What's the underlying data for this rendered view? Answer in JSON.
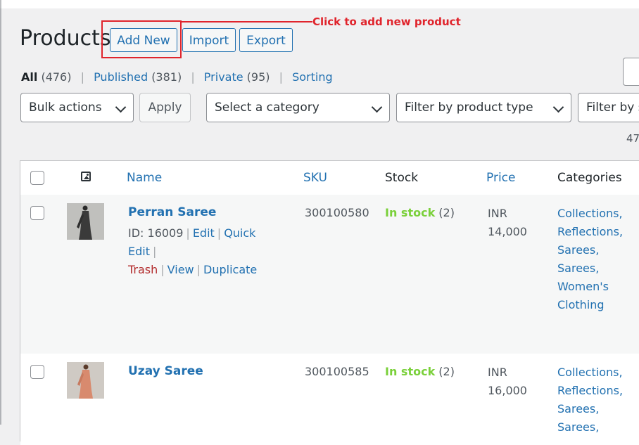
{
  "page": {
    "title": "Products",
    "buttons": {
      "add_new": "Add New",
      "import": "Import",
      "export": "Export"
    }
  },
  "annotation": {
    "text": "Click to add new product",
    "color": "#e0242c"
  },
  "views": {
    "all": {
      "label": "All",
      "count": "(476)"
    },
    "published": {
      "label": "Published",
      "count": "(381)"
    },
    "private": {
      "label": "Private",
      "count": "(95)"
    },
    "sorting": {
      "label": "Sorting"
    },
    "separator": "|"
  },
  "filters": {
    "bulk_actions": "Bulk actions",
    "apply": "Apply",
    "category": "Select a category",
    "product_type": "Filter by product type",
    "stock": "Filter by s"
  },
  "items_count": "47",
  "table": {
    "headers": {
      "name": "Name",
      "sku": "SKU",
      "stock": "Stock",
      "price": "Price",
      "categories": "Categories"
    },
    "rows": [
      {
        "name": "Perran Saree",
        "id": "ID: 16009",
        "actions": {
          "edit": "Edit",
          "quick_edit": "Quick Edit",
          "trash": "Trash",
          "view": "View",
          "duplicate": "Duplicate"
        },
        "sku": "300100580",
        "stock_status": "In stock",
        "stock_count": "(2)",
        "price_currency": "INR",
        "price_amount": "14,000",
        "categories": [
          "Collections,",
          "Reflections,",
          "Sarees,",
          "Sarees,",
          "Women's",
          "Clothing"
        ],
        "thumb_color": "#3a3a3a"
      },
      {
        "name": "Uzay Saree",
        "sku": "300100585",
        "stock_status": "In stock",
        "stock_count": "(2)",
        "price_currency": "INR",
        "price_amount": "16,000",
        "categories": [
          "Collections,",
          "Reflections,",
          "Sarees,",
          "Sarees,"
        ],
        "thumb_color": "#d88a6e"
      }
    ]
  },
  "colors": {
    "link": "#2271b1",
    "in_stock": "#7ad03a",
    "trash": "#b32d2e"
  }
}
